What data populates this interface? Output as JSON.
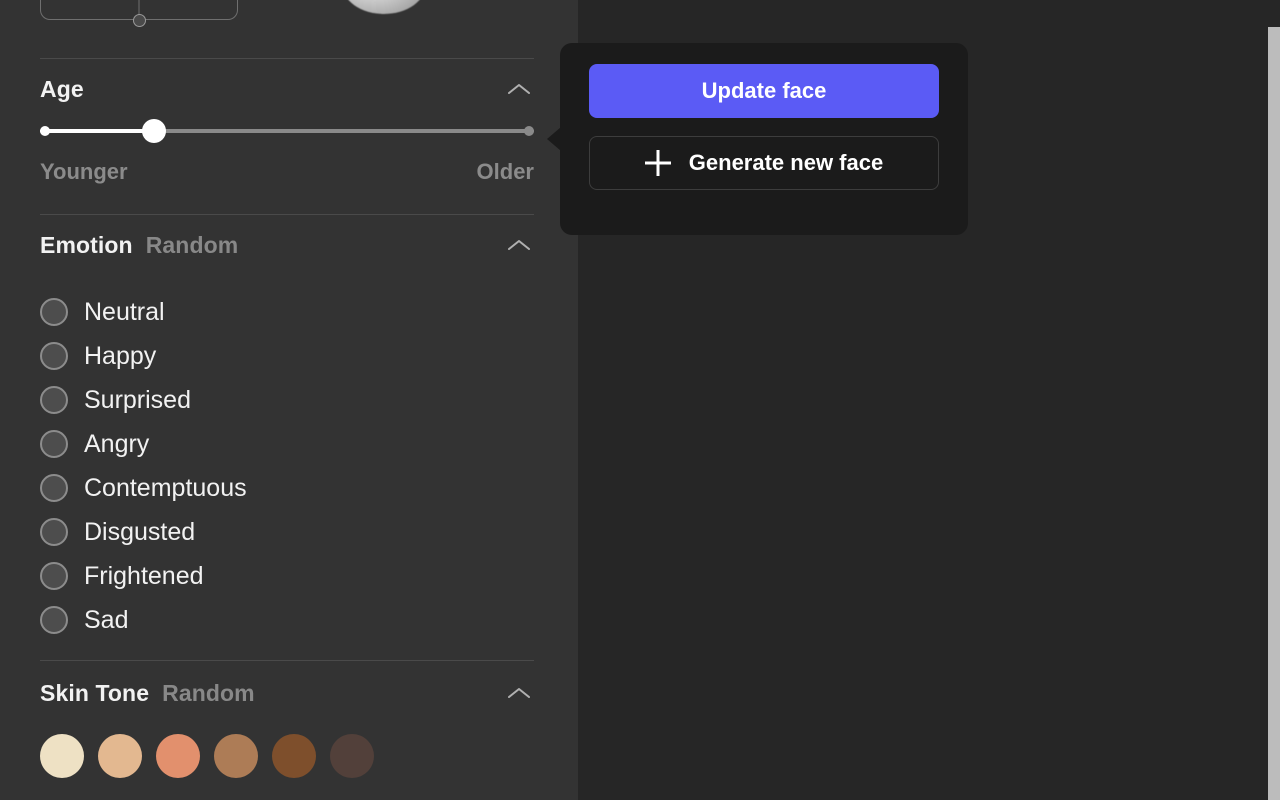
{
  "app": {
    "accent_color": "#5b5bf5",
    "sidebar_bg": "#333333",
    "canvas_bg": "#262626",
    "popup_bg": "#1b1b1b"
  },
  "sidebar": {
    "xy_pad": {
      "name": "head-pose-pad",
      "handle_label": "pose-handle"
    },
    "sections": [
      {
        "id": "age",
        "title": "Age",
        "subtitle": "",
        "collapse_icon": "chevron-up-icon",
        "slider": {
          "min_label": "Younger",
          "max_label": "Older",
          "value_percent": 23
        }
      },
      {
        "id": "emotion",
        "title": "Emotion",
        "subtitle": "Random",
        "collapse_icon": "chevron-up-icon",
        "options": [
          {
            "label": "Neutral",
            "selected": false
          },
          {
            "label": "Happy",
            "selected": false
          },
          {
            "label": "Surprised",
            "selected": false
          },
          {
            "label": "Angry",
            "selected": false
          },
          {
            "label": "Contemptuous",
            "selected": false
          },
          {
            "label": "Disgusted",
            "selected": false
          },
          {
            "label": "Frightened",
            "selected": false
          },
          {
            "label": "Sad",
            "selected": false
          }
        ]
      },
      {
        "id": "skin-tone",
        "title": "Skin Tone",
        "subtitle": "Random",
        "collapse_icon": "chevron-up-icon",
        "swatches": [
          {
            "name": "skin-tone-1",
            "color": "#eee1c4"
          },
          {
            "name": "skin-tone-2",
            "color": "#e3b890"
          },
          {
            "name": "skin-tone-3",
            "color": "#e2906d"
          },
          {
            "name": "skin-tone-4",
            "color": "#ad7c56"
          },
          {
            "name": "skin-tone-5",
            "color": "#7e4f2c"
          },
          {
            "name": "skin-tone-6",
            "color": "#52403a"
          }
        ]
      }
    ]
  },
  "popup": {
    "update_button": "Update face",
    "generate_button": "Generate new face",
    "generate_icon": "plus-icon",
    "arrow": "left-pointing-arrow"
  },
  "scrollbar": {
    "name": "page-scrollbar",
    "thumb_name": "page-scrollbar-thumb"
  }
}
